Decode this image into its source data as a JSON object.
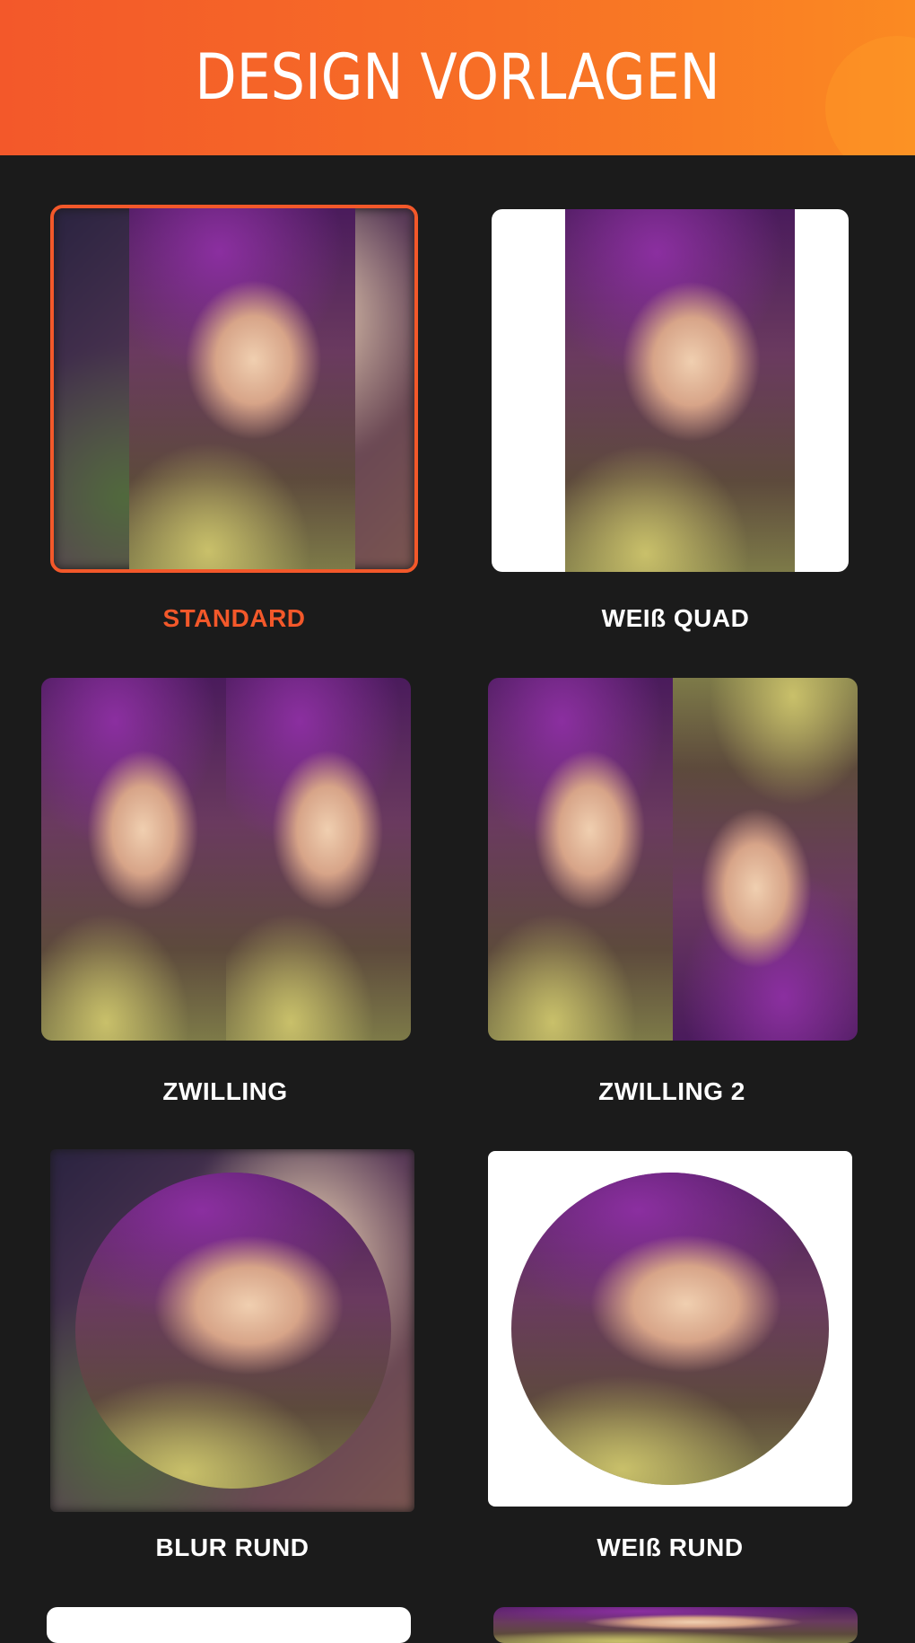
{
  "header": {
    "title": "DESIGN VORLAGEN"
  },
  "colors": {
    "accent": "#f3582a",
    "background": "#1b1b1b",
    "header_gradient_start": "#f3582a",
    "header_gradient_end": "#fb8a22"
  },
  "templates": [
    {
      "label": "STANDARD",
      "selected": true
    },
    {
      "label": "WEIß QUAD",
      "selected": false
    },
    {
      "label": "ZWILLING",
      "selected": false
    },
    {
      "label": "ZWILLING 2",
      "selected": false
    },
    {
      "label": "BLUR RUND",
      "selected": false
    },
    {
      "label": "WEIß RUND",
      "selected": false
    }
  ]
}
